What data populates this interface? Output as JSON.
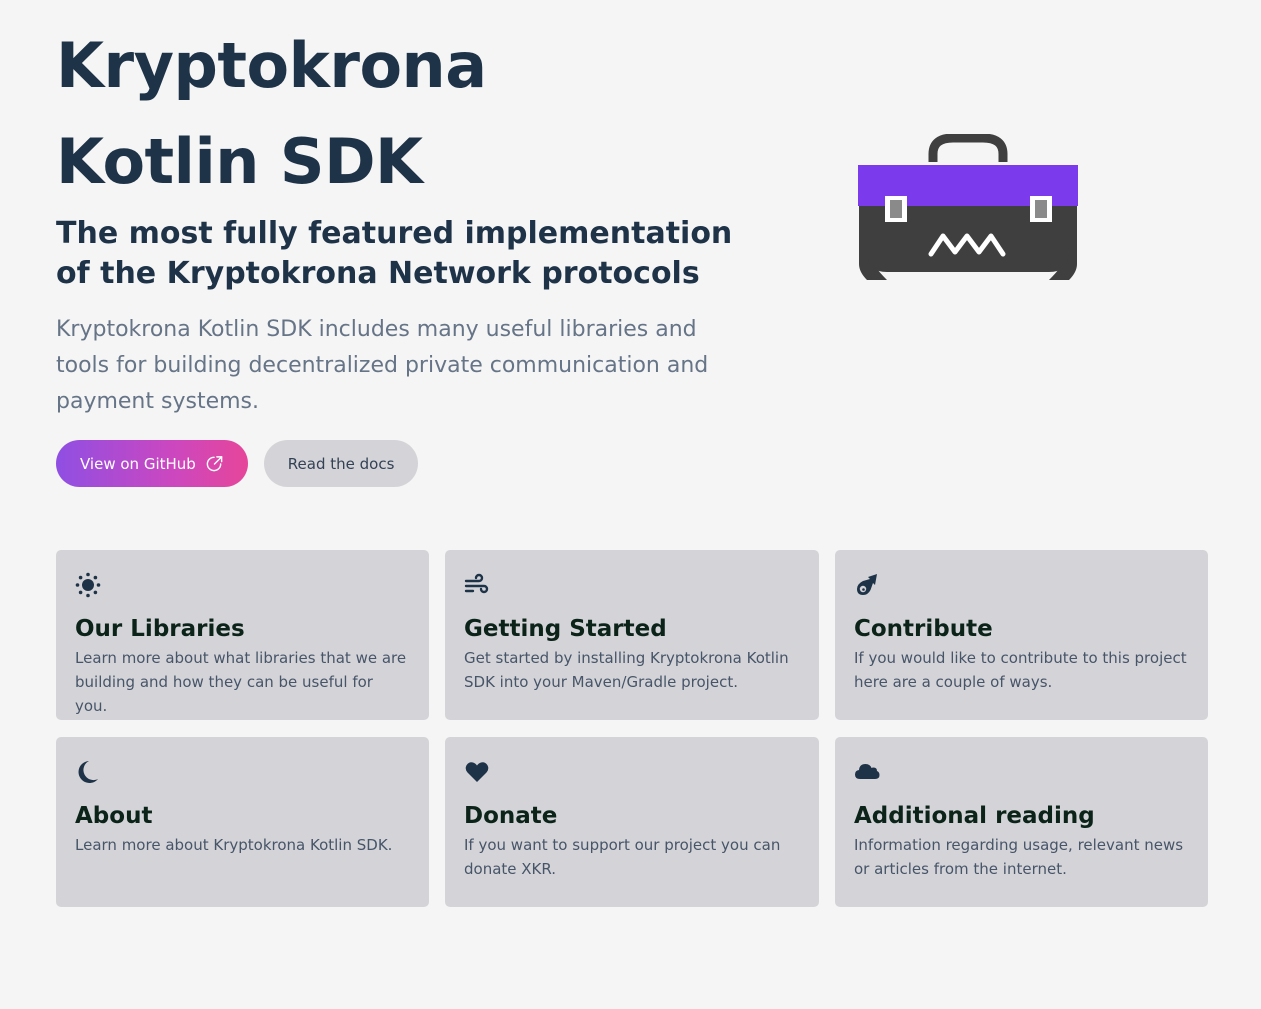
{
  "hero": {
    "title_line1": "Kryptokrona",
    "title_line2": "Kotlin SDK",
    "subtitle": "The most fully featured implementation of the Kryptokrona Network protocols",
    "description": "Kryptokrona Kotlin SDK includes many useful libraries and tools for building decentralized private communication and payment systems.",
    "primary_button": "View on GitHub",
    "secondary_button": "Read the docs"
  },
  "illustration": {
    "name": "toolbox-icon",
    "lid_color": "#7c3aed",
    "body_color": "#3f3f3f"
  },
  "colors": {
    "background": "#f5f5f5",
    "heading": "#1f3348",
    "card_background": "#d4d4d8",
    "card_title": "#0b2318",
    "button_gradient_start": "#8f4fe3",
    "button_gradient_end": "#e6469a"
  },
  "cards": [
    {
      "icon": "sun-icon",
      "title": "Our Libraries",
      "description": "Learn more about what libraries that we are building and how they can be useful for you."
    },
    {
      "icon": "wind-icon",
      "title": "Getting Started",
      "description": "Get started by installing Kryptokrona Kotlin SDK into your Maven/Gradle project."
    },
    {
      "icon": "meteor-icon",
      "title": "Contribute",
      "description": "If you would like to contribute to this project here are a couple of ways."
    },
    {
      "icon": "moon-icon",
      "title": "About",
      "description": "Learn more about Kryptokrona Kotlin SDK."
    },
    {
      "icon": "heart-icon",
      "title": "Donate",
      "description": "If you want to support our project you can donate XKR."
    },
    {
      "icon": "cloud-icon",
      "title": "Additional reading",
      "description": "Information regarding usage, relevant news or articles from the internet."
    }
  ]
}
